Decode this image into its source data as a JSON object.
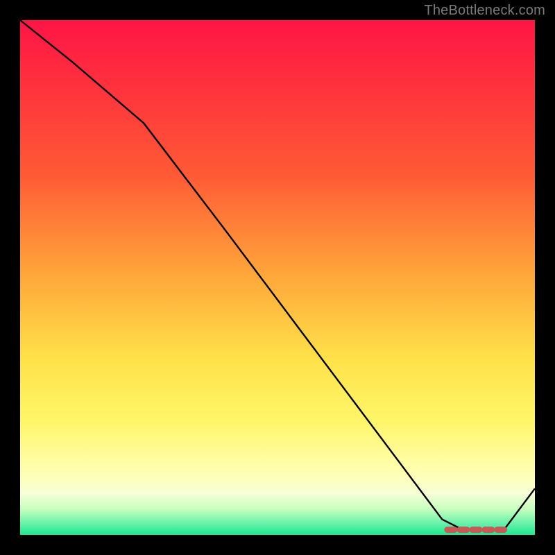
{
  "attribution": "TheBottleneck.com",
  "chart_data": {
    "type": "line",
    "title": "",
    "xlabel": "",
    "ylabel": "",
    "xlim": [
      0,
      100
    ],
    "ylim": [
      0,
      100
    ],
    "series": [
      {
        "name": "curve",
        "x": [
          0,
          10,
          24,
          40,
          55,
          70,
          82,
          86,
          90,
          94,
          100
        ],
        "y": [
          100,
          92,
          80,
          59,
          39,
          19,
          3,
          1,
          1,
          1,
          9
        ]
      }
    ],
    "highlight_segment": {
      "name": "flat-minimum",
      "x_start": 83,
      "x_end": 94,
      "y": 1
    },
    "background_gradient": {
      "top": "#ff1546",
      "mid_high": "#ffa83b",
      "mid_low": "#fff66a",
      "bottom": "#1ee890"
    }
  }
}
